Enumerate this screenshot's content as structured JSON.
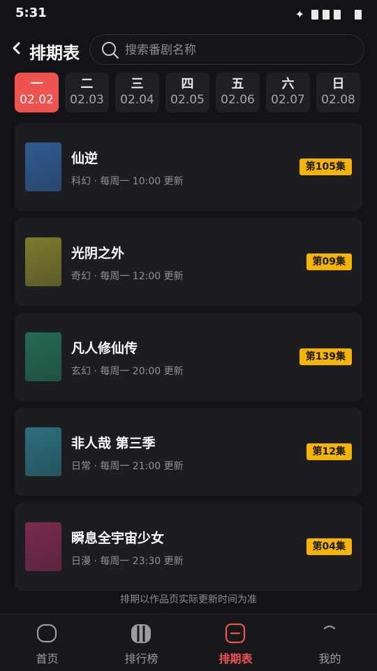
{
  "status": {
    "time": "5:31"
  },
  "header": {
    "title": "排期表",
    "search_placeholder": "搜索番剧名称"
  },
  "days": [
    {
      "weekday": "一",
      "date": "02.02",
      "active": true
    },
    {
      "weekday": "二",
      "date": "02.03",
      "active": false
    },
    {
      "weekday": "三",
      "date": "02.04",
      "active": false
    },
    {
      "weekday": "四",
      "date": "02.05",
      "active": false
    },
    {
      "weekday": "五",
      "date": "02.06",
      "active": false
    },
    {
      "weekday": "六",
      "date": "02.07",
      "active": false
    },
    {
      "weekday": "日",
      "date": "02.08",
      "active": false
    }
  ],
  "shows": [
    {
      "title": "仙逆",
      "meta": "科幻 · 每周一 10:00 更新",
      "episode": "第105集",
      "poster_color": "#2f5b92"
    },
    {
      "title": "光阴之外",
      "meta": "奇幻 · 每周一 12:00 更新",
      "episode": "第09集",
      "poster_color": "#7d7a2e"
    },
    {
      "title": "凡人修仙传",
      "meta": "玄幻 · 每周一 20:00 更新",
      "episode": "第139集",
      "poster_color": "#246a54"
    },
    {
      "title": "非人哉 第三季",
      "meta": "日常 · 每周一 21:00 更新",
      "episode": "第12集",
      "poster_color": "#2c6f7e"
    },
    {
      "title": "瞬息全宇宙少女",
      "meta": "日漫 · 每周一 23:30 更新",
      "episode": "第04集",
      "poster_color": "#7a2a4e"
    }
  ],
  "note": "排期以作品页实际更新时间为准",
  "nav": [
    {
      "label": "首页",
      "icon": "home-icon",
      "active": false
    },
    {
      "label": "排行榜",
      "icon": "ranking-icon",
      "active": false
    },
    {
      "label": "排期表",
      "icon": "schedule-icon",
      "active": true
    },
    {
      "label": "我的",
      "icon": "profile-icon",
      "active": false
    }
  ],
  "colors": {
    "accent": "#f0524f",
    "badge": "#f4b400",
    "background": "#121316",
    "card": "#1c1d21"
  }
}
